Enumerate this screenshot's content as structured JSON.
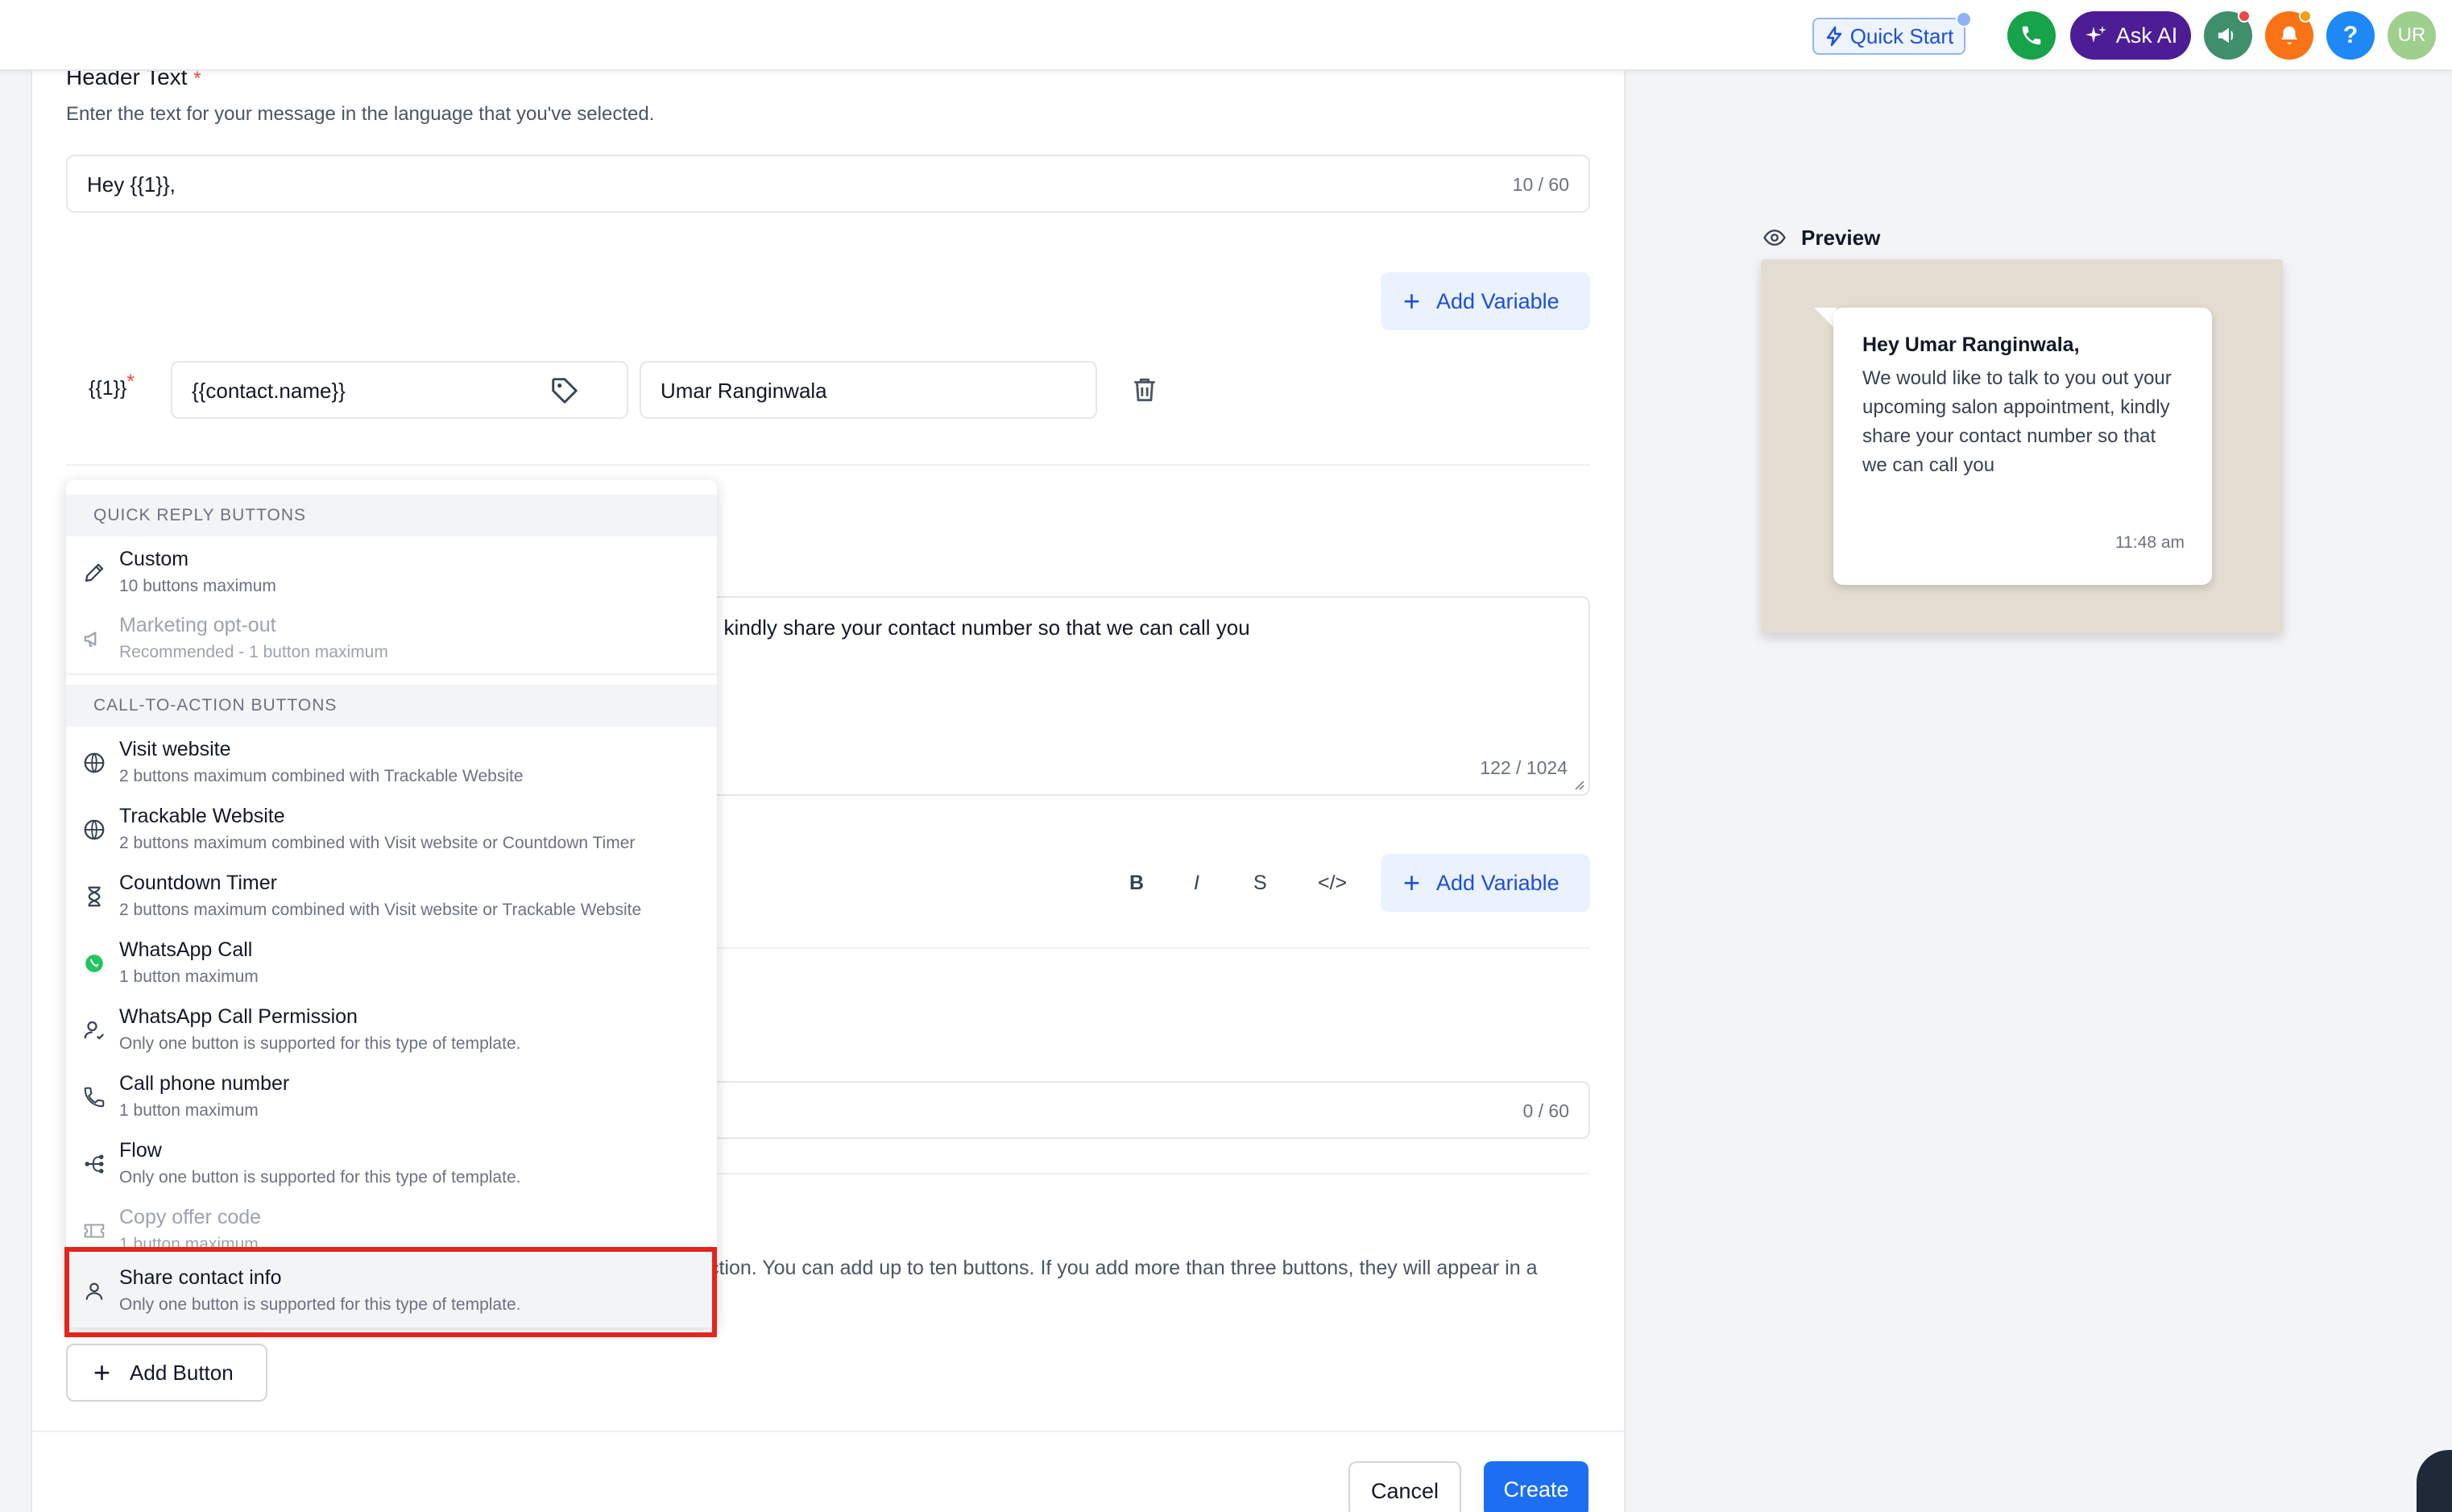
{
  "topbar": {
    "quick_start": "Quick Start",
    "ask_ai": "Ask AI",
    "avatar_initials": "UR"
  },
  "header_text": {
    "label": "Header Text",
    "required_mark": "*",
    "hint": "Enter the text for your message in the language that you've selected.",
    "value": "Hey {{1}},",
    "counter": "10 / 60",
    "add_variable": "Add Variable"
  },
  "variable_row": {
    "token": "{{1}}",
    "required_mark": "*",
    "attribute": "{{contact.name}}",
    "sample_value": "Umar Ranginwala"
  },
  "body": {
    "visible_text": ", kindly share your contact number so that we can call you",
    "counter": "122 / 1024",
    "format_bold": "B",
    "format_italic": "I",
    "format_strike": "S",
    "format_code": "</>",
    "add_variable": "Add Variable"
  },
  "footer": {
    "counter": "0 / 60"
  },
  "buttons_section": {
    "hint_visible": "ction. You can add up to ten buttons. If you add more than three buttons, they will appear in a",
    "add_button": "Add Button"
  },
  "dropdown": {
    "groups": [
      {
        "header": "QUICK REPLY BUTTONS",
        "items": [
          {
            "icon": "pencil-icon",
            "title": "Custom",
            "desc": "10 buttons maximum",
            "disabled": false
          },
          {
            "icon": "megaphone-icon",
            "title": "Marketing opt-out",
            "desc": "Recommended - 1 button maximum",
            "disabled": true
          }
        ]
      },
      {
        "header": "CALL-TO-ACTION BUTTONS",
        "items": [
          {
            "icon": "globe-icon",
            "title": "Visit website",
            "desc": "2 buttons maximum combined with Trackable Website",
            "disabled": false
          },
          {
            "icon": "globe-icon",
            "title": "Trackable Website",
            "desc": "2 buttons maximum combined with Visit website or Countdown Timer",
            "disabled": false
          },
          {
            "icon": "hourglass-icon",
            "title": "Countdown Timer",
            "desc": "2 buttons maximum combined with Visit website or Trackable Website",
            "disabled": false
          },
          {
            "icon": "whatsapp-icon",
            "title": "WhatsApp Call",
            "desc": "1 button maximum",
            "disabled": false
          },
          {
            "icon": "user-check-icon",
            "title": "WhatsApp Call Permission",
            "desc": "Only one button is supported for this type of template.",
            "disabled": false
          },
          {
            "icon": "phone-icon",
            "title": "Call phone number",
            "desc": "1 button maximum",
            "disabled": false
          },
          {
            "icon": "flow-icon",
            "title": "Flow",
            "desc": "Only one button is supported for this type of template.",
            "disabled": false
          },
          {
            "icon": "ticket-icon",
            "title": "Copy offer code",
            "desc": "1 button maximum",
            "disabled": true
          },
          {
            "icon": "user-icon",
            "title": "Share contact info",
            "desc": "Only one button is supported for this type of template.",
            "disabled": false
          }
        ]
      }
    ]
  },
  "preview": {
    "label": "Preview",
    "message_title": "Hey Umar Ranginwala,",
    "message_body": "We would like to talk to you out your upcoming salon appointment, kindly share your contact number so that we can call you",
    "time": "11:48 am"
  },
  "actions": {
    "cancel": "Cancel",
    "create": "Create"
  },
  "colors": {
    "primary": "#1d6ef0",
    "ask_ai": "#4c1d95",
    "highlight": "#e5241b",
    "whatsapp_green": "#16a34a"
  }
}
